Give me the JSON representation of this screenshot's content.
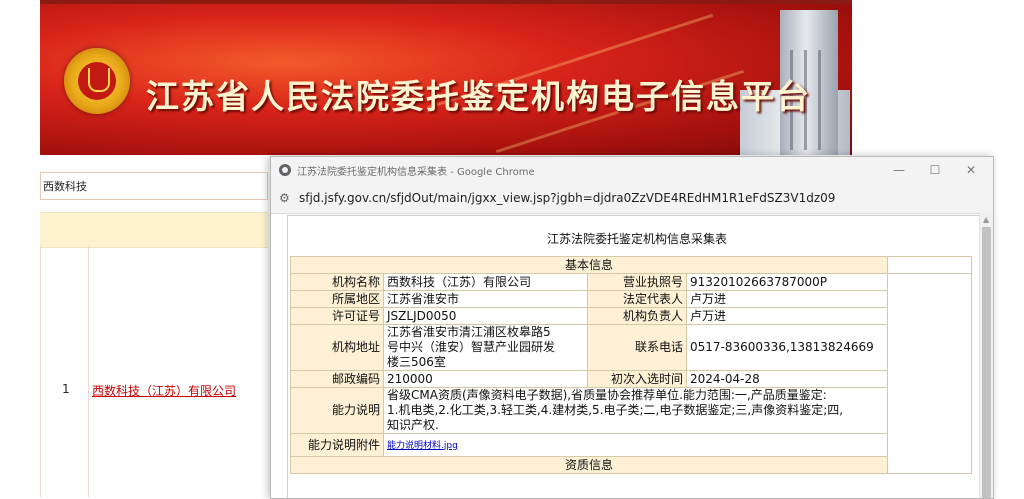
{
  "banner": {
    "title": "江苏省人民法院委托鉴定机构电子信息平台"
  },
  "search": {
    "value": "西数科技"
  },
  "results": [
    {
      "index": "1",
      "name": "西数科技（江苏）有限公司"
    }
  ],
  "window": {
    "title": "江苏法院委托鉴定机构信息采集表 - Google Chrome",
    "controls": {
      "minimize": "—",
      "maximize": "☐",
      "close": "✕"
    },
    "url": "sfjd.jsfy.gov.cn/sfjdOut/main/jgxx_view.jsp?jgbh=djdra0ZzVDE4REdHM1R1eFdSZ3V1dz09"
  },
  "form": {
    "title": "江苏法院委托鉴定机构信息采集表",
    "section_basic": "基本信息",
    "org_name_label": "机构名称",
    "org_name": "西数科技（江苏）有限公司",
    "license_label": "营业执照号",
    "license": "91320102663787000P",
    "region_label": "所属地区",
    "region": "江苏省淮安市",
    "legal_rep_label": "法定代表人",
    "legal_rep": "卢万进",
    "permit_label": "许可证号",
    "permit": "JSZLJD0050",
    "head_label": "机构负责人",
    "head": "卢万进",
    "address_label": "机构地址",
    "address_lines": [
      "江苏省淮安市清江浦区枚皋路5",
      "号中兴（淮安）智慧产业园研发",
      "楼三506室"
    ],
    "phone_label": "联系电话",
    "phone": "0517-83600336,13813824669",
    "postcode_label": "邮政编码",
    "postcode": "210000",
    "first_date_label": "初次入选时间",
    "first_date": "2024-04-28",
    "ability_label": "能力说明",
    "ability_lines": [
      "省级CMA资质(声像资料电子数据),省质量协会推荐单位.能力范围:一,产品质量鉴定:",
      "1.机电类,2.化工类,3.轻工类,4.建材类,5.电子类;二,电子数据鉴定;三,声像资料鉴定;四,",
      "知识产权."
    ],
    "attachment_label": "能力说明附件",
    "attachment": "能力说明材料.jpg",
    "section_qual": "资质信息"
  }
}
